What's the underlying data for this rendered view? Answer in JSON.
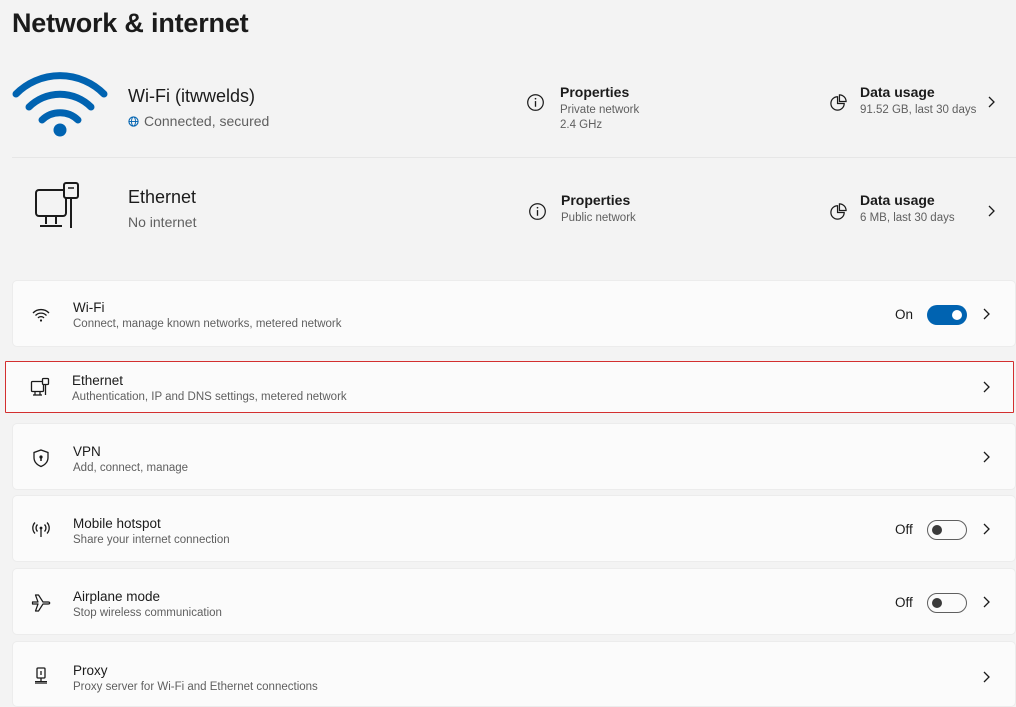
{
  "page": {
    "title": "Network & internet"
  },
  "wifi_card": {
    "name": "Wi-Fi (itwwelds)",
    "status": "Connected, secured",
    "properties_title": "Properties",
    "properties_line1": "Private network",
    "properties_line2": "2.4 GHz",
    "usage_title": "Data usage",
    "usage_value": "91.52 GB, last 30 days",
    "accent": "#0063b1"
  },
  "ethernet_card": {
    "name": "Ethernet",
    "status": "No internet",
    "properties_title": "Properties",
    "properties_line1": "Public network",
    "usage_title": "Data usage",
    "usage_value": "6 MB, last 30 days"
  },
  "settings": {
    "wifi": {
      "title": "Wi-Fi",
      "subtitle": "Connect, manage known networks, metered network",
      "toggle_label": "On",
      "icon": "wifi-icon"
    },
    "ethernet": {
      "title": "Ethernet",
      "subtitle": "Authentication, IP and DNS settings, metered network",
      "icon": "ethernet-icon"
    },
    "vpn": {
      "title": "VPN",
      "subtitle": "Add, connect, manage",
      "icon": "shield-icon"
    },
    "hotspot": {
      "title": "Mobile hotspot",
      "subtitle": "Share your internet connection",
      "toggle_label": "Off",
      "icon": "hotspot-icon"
    },
    "airplane": {
      "title": "Airplane mode",
      "subtitle": "Stop wireless communication",
      "toggle_label": "Off",
      "icon": "airplane-icon"
    },
    "proxy": {
      "title": "Proxy",
      "subtitle": "Proxy server for Wi-Fi and Ethernet connections",
      "icon": "proxy-icon"
    }
  },
  "colors": {
    "accent": "#0063b1",
    "highlight_border": "#d32f2f",
    "background": "#f3f3f3"
  }
}
